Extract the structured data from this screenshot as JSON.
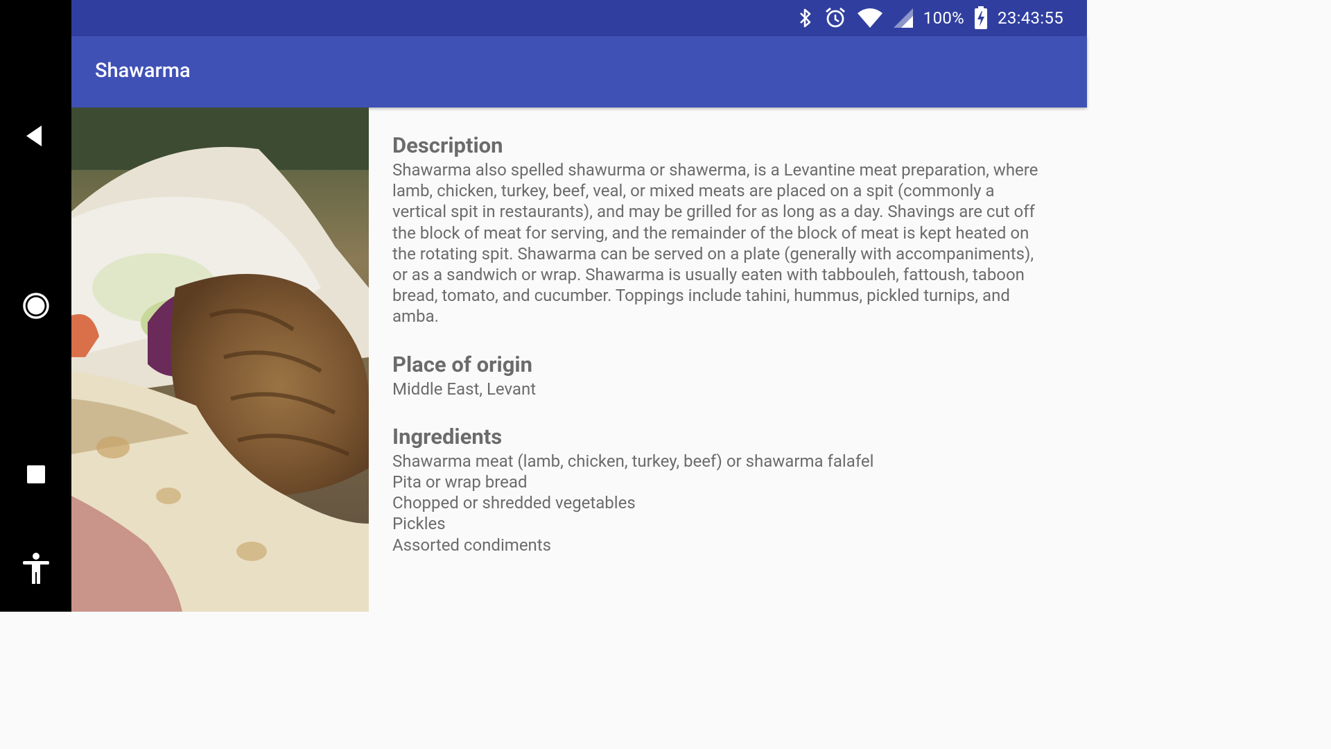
{
  "status_bar": {
    "battery": "100%",
    "time": "23:43:55",
    "icons": [
      "bluetooth-icon",
      "alarm-icon",
      "wifi-icon",
      "signal-icon",
      "battery-charging-icon"
    ]
  },
  "app_bar": {
    "title": "Shawarma"
  },
  "nav_bar": {
    "icons": [
      "back-icon",
      "home-icon",
      "recents-icon",
      "accessibility-icon"
    ]
  },
  "details": {
    "description_title": "Description",
    "description_text": "Shawarma also spelled shawurma or shawerma, is a Levantine meat preparation, where lamb, chicken, turkey, beef, veal, or mixed meats are placed on a spit (commonly a vertical spit in restaurants), and may be grilled for as long as a day. Shavings are cut off the block of meat for serving, and the remainder of the block of meat is kept heated on the rotating spit. Shawarma can be served on a plate (generally with accompaniments), or as a sandwich or wrap. Shawarma is usually eaten with tabbouleh, fattoush, taboon bread, tomato, and cucumber. Toppings include tahini, hummus, pickled turnips, and amba.",
    "origin_title": "Place of origin",
    "origin_text": "Middle East, Levant",
    "ingredients_title": "Ingredients",
    "ingredients": [
      "Shawarma meat (lamb, chicken, turkey, beef) or shawarma falafel",
      "Pita or wrap bread",
      "Chopped or shredded vegetables",
      "Pickles",
      "Assorted condiments"
    ]
  }
}
